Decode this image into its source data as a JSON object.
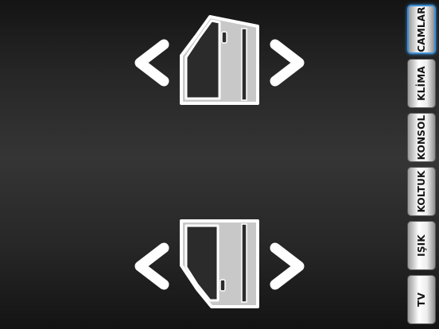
{
  "window_controls": {
    "front": {
      "left_icon": "chevron-left-icon",
      "door_icon": "front-door-window-icon",
      "right_icon": "chevron-right-icon"
    },
    "rear": {
      "left_icon": "chevron-left-icon",
      "door_icon": "rear-door-window-icon",
      "right_icon": "chevron-right-icon"
    }
  },
  "side_menu": {
    "tabs": [
      {
        "label": "CAMLAR",
        "active": true
      },
      {
        "label": "KLİMA",
        "active": false
      },
      {
        "label": "KONSOL",
        "active": false
      },
      {
        "label": "KOLTUK",
        "active": false
      },
      {
        "label": "IŞIK",
        "active": false
      },
      {
        "label": "TV",
        "active": false
      }
    ]
  },
  "colors": {
    "background_dark": "#141414",
    "background_mid": "#353535",
    "icon_white": "#ffffff",
    "door_fill": "#c8c8c8",
    "active_tab_border": "#3e8fd6"
  }
}
